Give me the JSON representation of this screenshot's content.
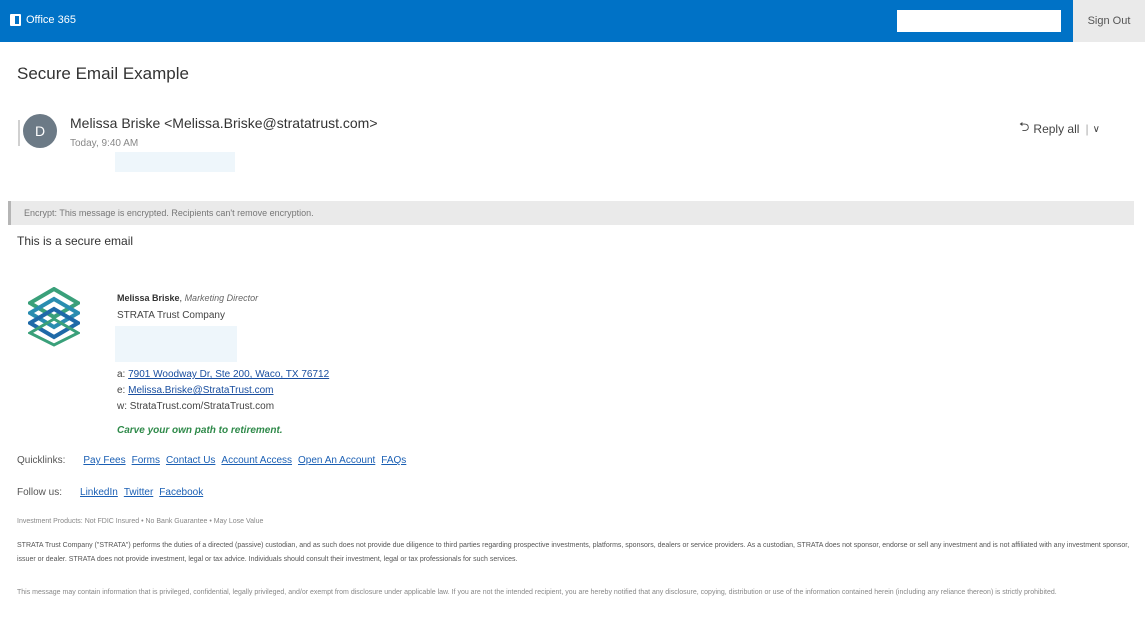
{
  "topbar": {
    "brand": "Office 365",
    "search_value": "",
    "signout_label": "Sign Out",
    "color": "#0072c6"
  },
  "message": {
    "subject": "Secure Email Example",
    "avatar_initial": "D",
    "sender": "Melissa Briske <Melissa.Briske@stratatrust.com>",
    "time": "Today, 9:40 AM",
    "reply_all_label": "Reply all",
    "encrypt_notice": "Encrypt: This message is encrypted. Recipients can't remove encryption.",
    "body_text": "This is a secure email"
  },
  "signature": {
    "name": "Melissa Briske",
    "title": "Marketing Director",
    "company": "STRATA Trust Company",
    "address_prefix": "a:",
    "address": "7901 Woodway Dr, Ste 200, Waco, TX 76712",
    "email_prefix": "e:",
    "email": "Melissa.Briske@StrataTrust.com",
    "web_prefix": "w:",
    "web": "StrataTrust.com/StrataTrust.com",
    "tagline": "Carve your own path to retirement."
  },
  "quicklinks": {
    "label": "Quicklinks:",
    "items": [
      "Pay Fees",
      "Forms",
      "Contact Us",
      "Account Access",
      "Open An Account",
      "FAQs"
    ]
  },
  "follow": {
    "label": "Follow us:",
    "items": [
      "LinkedIn",
      "Twitter",
      "Facebook"
    ]
  },
  "disclaimers": {
    "line1": "Investment Products: Not FDIC Insured • No Bank Guarantee • May Lose Value",
    "para1": "STRATA Trust Company (\"STRATA\") performs the duties of a directed (passive) custodian, and as such does not provide due diligence to third parties regarding prospective investments, platforms, sponsors, dealers or service providers. As a custodian, STRATA does not sponsor, endorse or sell any investment and is not affiliated with any investment sponsor, issuer or dealer. STRATA does not provide investment, legal or tax advice. Individuals should consult their investment, legal or tax professionals for such services.",
    "para2": "This message may contain information that is privileged, confidential, legally privileged, and/or exempt from disclosure under applicable law. If you are not the intended recipient, you are hereby notified that any disclosure, copying, distribution or use of the information contained herein (including any reliance thereon) is strictly prohibited."
  }
}
